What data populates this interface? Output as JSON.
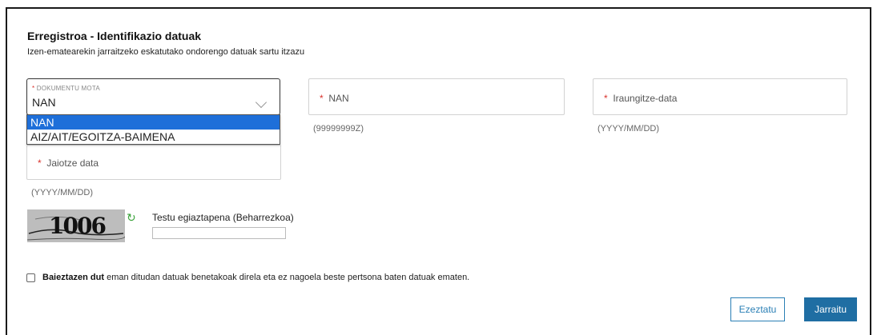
{
  "header": {
    "title": "Erregistroa - Identifikazio datuak",
    "subtitle": "Izen-ematearekin jarraitzeko eskatutako ondorengo datuak sartu itzazu"
  },
  "document_type": {
    "label": "DOKUMENTU MOTA",
    "required_mark": "*",
    "selected": "NAN",
    "options": [
      "NAN",
      "AIZ/AIT/EGOITZA-BAIMENA"
    ]
  },
  "nan": {
    "placeholder": "NAN",
    "required_mark": "*",
    "hint": "(99999999Z)"
  },
  "expiry": {
    "placeholder": "Iraungitze-data",
    "required_mark": "*",
    "hint": "(YYYY/MM/DD)"
  },
  "birth": {
    "placeholder": "Jaiotze data",
    "required_mark": "*",
    "hint": "(YYYY/MM/DD)"
  },
  "captcha": {
    "image_text": "1006",
    "label": "Testu egiaztapena (Beharrezkoa)",
    "value": "",
    "refresh_icon": "refresh-icon"
  },
  "confirm": {
    "bold": "Baieztazen dut",
    "text": " eman ditudan datuak benetakoak direla eta ez nagoela beste pertsona baten datuak ematen."
  },
  "buttons": {
    "cancel": "Ezeztatu",
    "next": "Jarraitu"
  },
  "colors": {
    "primary": "#1f6ea3",
    "required": "#d9322c",
    "selected_option": "#1e6fd9"
  }
}
